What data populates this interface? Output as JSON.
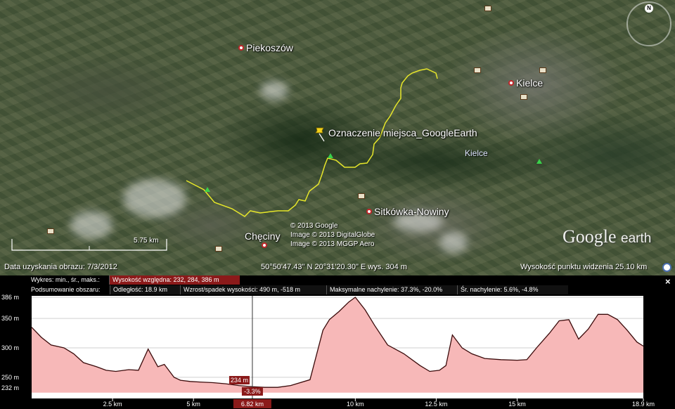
{
  "map": {
    "places": [
      {
        "name": "Piekoszów"
      },
      {
        "name": "Kielce"
      },
      {
        "name": "Sitkówka-Nowiny"
      },
      {
        "name": "Chęciny"
      }
    ],
    "placemark_label": "Oznaczenie miejsca_GoogleEarth",
    "kielce_region_label": "Kielce",
    "copyright": [
      "© 2013 Google",
      "Image © 2013 DigitalGlobe",
      "Image © 2013 MGGP Aero"
    ],
    "brand": {
      "google": "Google",
      "earth": "earth"
    },
    "scale_label": "5.75 km",
    "compass_n": "N",
    "route_color": "#e6e62a"
  },
  "status_bar": {
    "imagery_date": "Data uzyskania obrazu: 7/3/2012",
    "coordinates": "50°50'47.43\" N  20°31'20.30\" E  wys.  304 m",
    "eye_altitude": "Wysokość punktu widzenia    25.10 km"
  },
  "elevation_panel": {
    "row1": {
      "label": "Wykres: min., śr., maks.:",
      "selected": "Wysokość względna: 232, 284, 386 m"
    },
    "row2": {
      "label": "Podsumowanie obszaru:",
      "distance": "Odległość: 18.9 km",
      "gain_loss": "Wzrost/spadek wysokości: 490 m, -518 m",
      "max_slope": "Maksymalne nachylenie: 37.3%, -20.0%",
      "avg_slope": "Śr. nachylenie: 5.6%, -4.8%"
    },
    "close_label": "×",
    "cursor": {
      "elevation": "234 m",
      "slope": "-3.3%",
      "distance": "6.82 km",
      "x_km": 6.82
    },
    "selected_color": "#8b1a1a",
    "fill_color": "#f7b8b8"
  },
  "chart_data": {
    "type": "area",
    "title": "",
    "xlabel": "",
    "ylabel": "",
    "xlim": [
      0,
      18.9
    ],
    "ylim": [
      232,
      386
    ],
    "y_ticks": [
      "386 m",
      "350 m",
      "300 m",
      "250 m",
      "232 m"
    ],
    "y_tick_values": [
      386,
      350,
      300,
      250,
      232
    ],
    "x_ticks": [
      "2.5 km",
      "5 km",
      "10 km",
      "12.5 km",
      "15 km",
      "18.9 km"
    ],
    "x_tick_values": [
      2.5,
      5,
      10,
      12.5,
      15,
      18.9
    ],
    "series": [
      {
        "x": [
          0,
          0.3,
          0.6,
          1.0,
          1.3,
          1.6,
          2.0,
          2.3,
          2.6,
          3.0,
          3.3,
          3.6,
          3.9,
          4.1,
          4.4,
          4.6,
          4.9,
          5.2,
          5.6,
          6.0,
          6.4,
          6.82,
          7.2,
          7.6,
          8.0,
          8.6,
          9.0,
          9.2,
          9.5,
          9.8,
          10.0,
          10.3,
          10.6,
          11.0,
          11.5,
          12.0,
          12.3,
          12.6,
          12.8,
          13.0,
          13.3,
          13.6,
          14.0,
          14.5,
          15.0,
          15.3,
          15.6,
          16.0,
          16.3,
          16.6,
          16.9,
          17.2,
          17.5,
          17.8,
          18.1,
          18.4,
          18.7,
          18.9
        ],
        "y": [
          335,
          318,
          305,
          300,
          290,
          275,
          268,
          262,
          260,
          263,
          262,
          298,
          268,
          272,
          250,
          245,
          243,
          242,
          241,
          239,
          236,
          234,
          233,
          233,
          236,
          246,
          330,
          348,
          362,
          378,
          386,
          365,
          338,
          305,
          290,
          270,
          260,
          262,
          270,
          322,
          300,
          290,
          282,
          280,
          279,
          280,
          300,
          325,
          346,
          348,
          315,
          332,
          357,
          357,
          348,
          330,
          310,
          303
        ]
      }
    ]
  }
}
